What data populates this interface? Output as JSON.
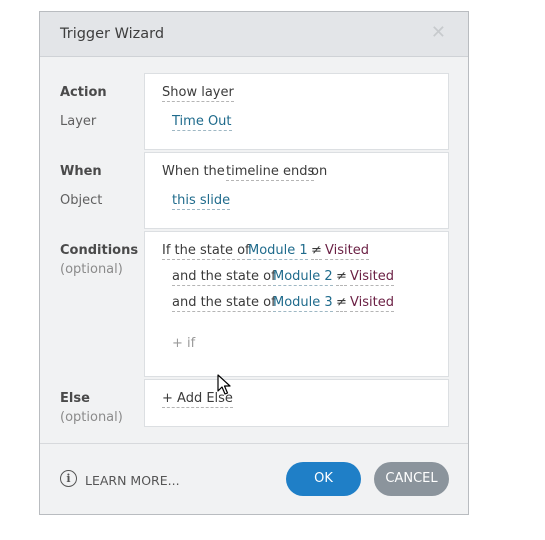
{
  "dialog": {
    "title": "Trigger Wizard",
    "close_icon": "close-icon",
    "close_glyph": "✕"
  },
  "action": {
    "label": "Action",
    "sub_label": "Layer",
    "value": "Show layer",
    "layer": "Time Out"
  },
  "when": {
    "label": "When",
    "sub_label": "Object",
    "prefix": "When the",
    "event": "timeline ends",
    "on": "on",
    "object": "this slide"
  },
  "conditions": {
    "label": "Conditions",
    "optional": "(optional)",
    "rows": [
      {
        "prefix": "If the state of",
        "object": "Module 1",
        "op": "≠",
        "state": "Visited"
      },
      {
        "prefix": "and the state of",
        "object": "Module 2",
        "op": "≠",
        "state": "Visited"
      },
      {
        "prefix": "and the state of",
        "object": "Module 3",
        "op": "≠",
        "state": "Visited"
      }
    ],
    "add_if": "+ if"
  },
  "else": {
    "label": "Else",
    "optional": "(optional)",
    "add_else": "+ Add Else"
  },
  "footer": {
    "info_icon": "info-icon",
    "info_glyph": "i",
    "learn_more": "LEARN MORE...",
    "ok": "OK",
    "cancel": "CANCEL"
  },
  "colors": {
    "ok_button": "#1f7fc7",
    "cancel_button": "#8b949c",
    "link": "#1f6b8c",
    "state_value": "#6a1f43"
  }
}
